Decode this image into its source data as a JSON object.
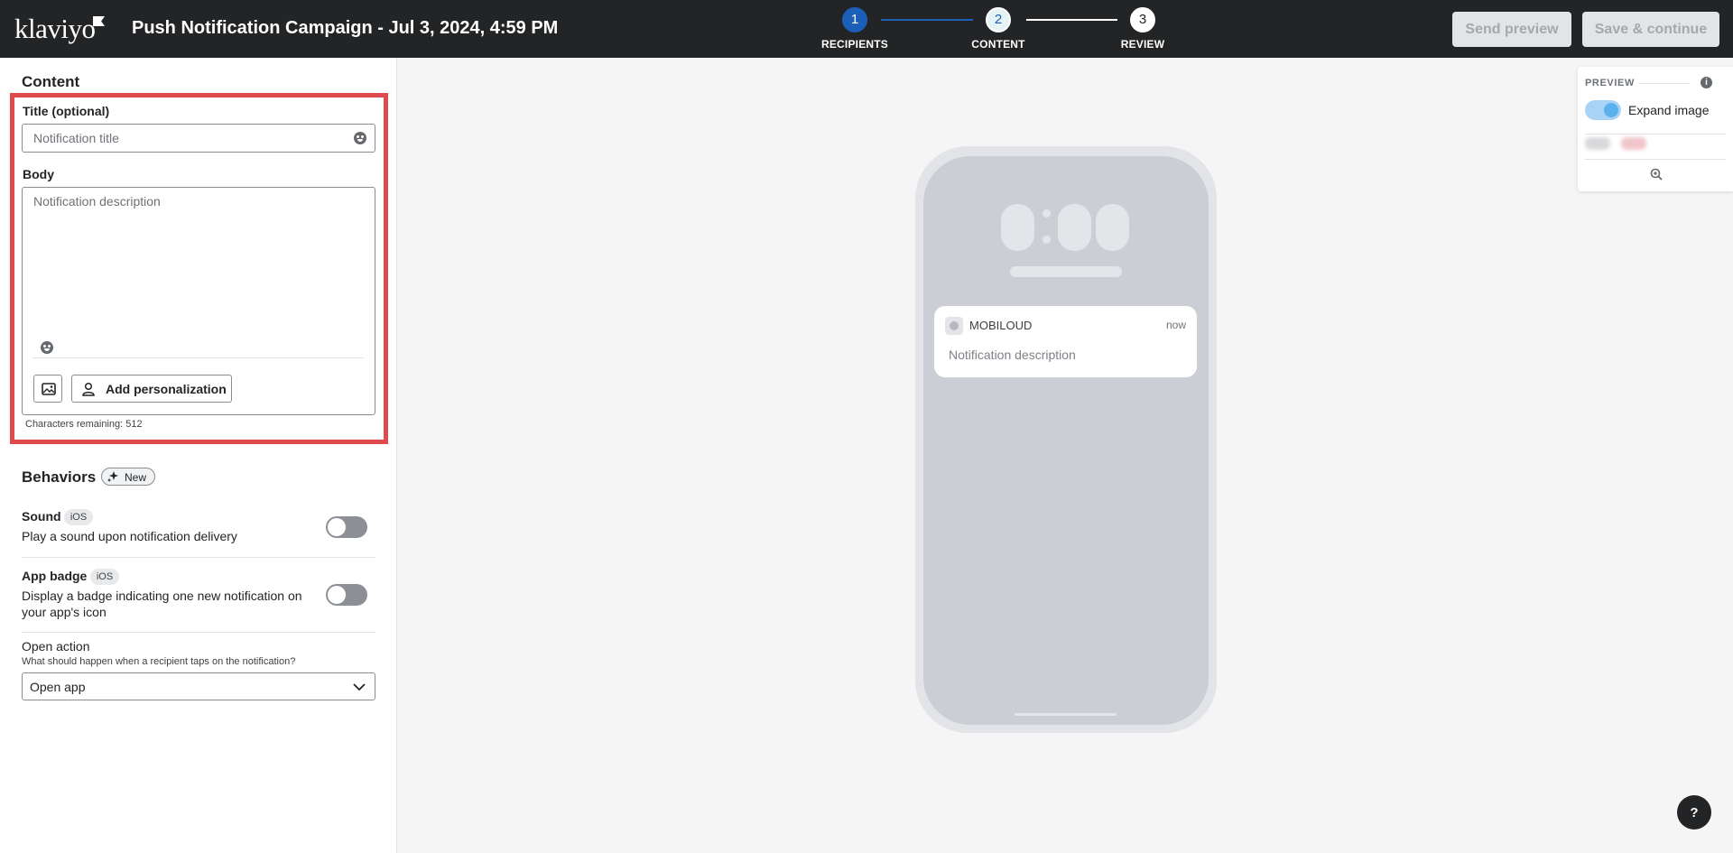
{
  "header": {
    "logo": "klaviyo",
    "campaign_title": "Push Notification Campaign - Jul 3, 2024, 4:59 PM",
    "steps": [
      {
        "number": "1",
        "label": "RECIPIENTS"
      },
      {
        "number": "2",
        "label": "CONTENT"
      },
      {
        "number": "3",
        "label": "REVIEW"
      }
    ],
    "send_preview_label": "Send preview",
    "save_continue_label": "Save & continue"
  },
  "content": {
    "section_title": "Content",
    "title_label": "Title (optional)",
    "title_placeholder": "Notification title",
    "body_label": "Body",
    "body_placeholder": "Notification description",
    "add_personalization_label": "Add personalization",
    "chars_remaining": "Characters remaining: 512"
  },
  "behaviors": {
    "section_title": "Behaviors",
    "new_badge": "New",
    "sound": {
      "title": "Sound",
      "badge": "iOS",
      "description": "Play a sound upon notification delivery"
    },
    "app_badge": {
      "title": "App badge",
      "badge": "iOS",
      "description": "Display a badge indicating one new notification on your app's icon"
    },
    "open_action": {
      "title": "Open action",
      "description": "What should happen when a recipient taps on the notification?",
      "selected": "Open app"
    }
  },
  "phone_preview": {
    "app_name": "MOBILOUD",
    "time": "now",
    "description": "Notification description"
  },
  "preview_panel": {
    "title": "PREVIEW",
    "expand_image_label": "Expand image"
  },
  "help_label": "?",
  "colors": {
    "accent_blue": "#1c5fb8",
    "highlight_red": "#e04a4f",
    "header_bg": "#232426"
  }
}
